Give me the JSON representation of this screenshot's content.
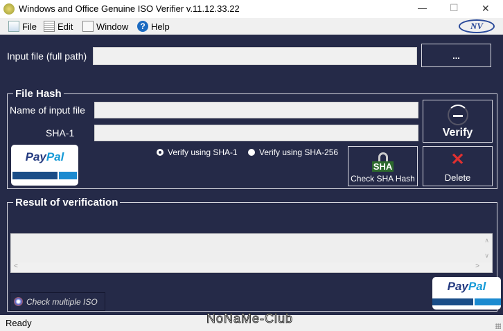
{
  "window": {
    "title": "Windows and Office Genuine ISO Verifier v.11.12.33.22",
    "minimize": "—",
    "maximize": "☐",
    "close": "✕"
  },
  "menu": [
    {
      "label": "File"
    },
    {
      "label": "Edit"
    },
    {
      "label": "Window"
    },
    {
      "label": "Help"
    }
  ],
  "logo": "NV",
  "input_file": {
    "label": "Input file (full path)",
    "value": "",
    "browse_label": "..."
  },
  "file_hash": {
    "title": "File Hash",
    "name_label": "Name of input file",
    "name_value": "",
    "sha1_label": "SHA-1",
    "sha1_value": "",
    "verify_label": "Verify",
    "delete_label": "Delete",
    "check_sha_label": "Check SHA Hash",
    "sha_icon_text": "SHA",
    "radio_sha1": "Verify using SHA-1",
    "radio_sha256": "Verify using SHA-256",
    "selected": "sha1"
  },
  "paypal": {
    "text1": "Pay",
    "text2": "Pal"
  },
  "result": {
    "title": "Result of verification",
    "value": "",
    "check_multiple_label": "Check multiple ISO"
  },
  "status": {
    "text": "Ready",
    "watermark": "NoNaMe-Club"
  }
}
